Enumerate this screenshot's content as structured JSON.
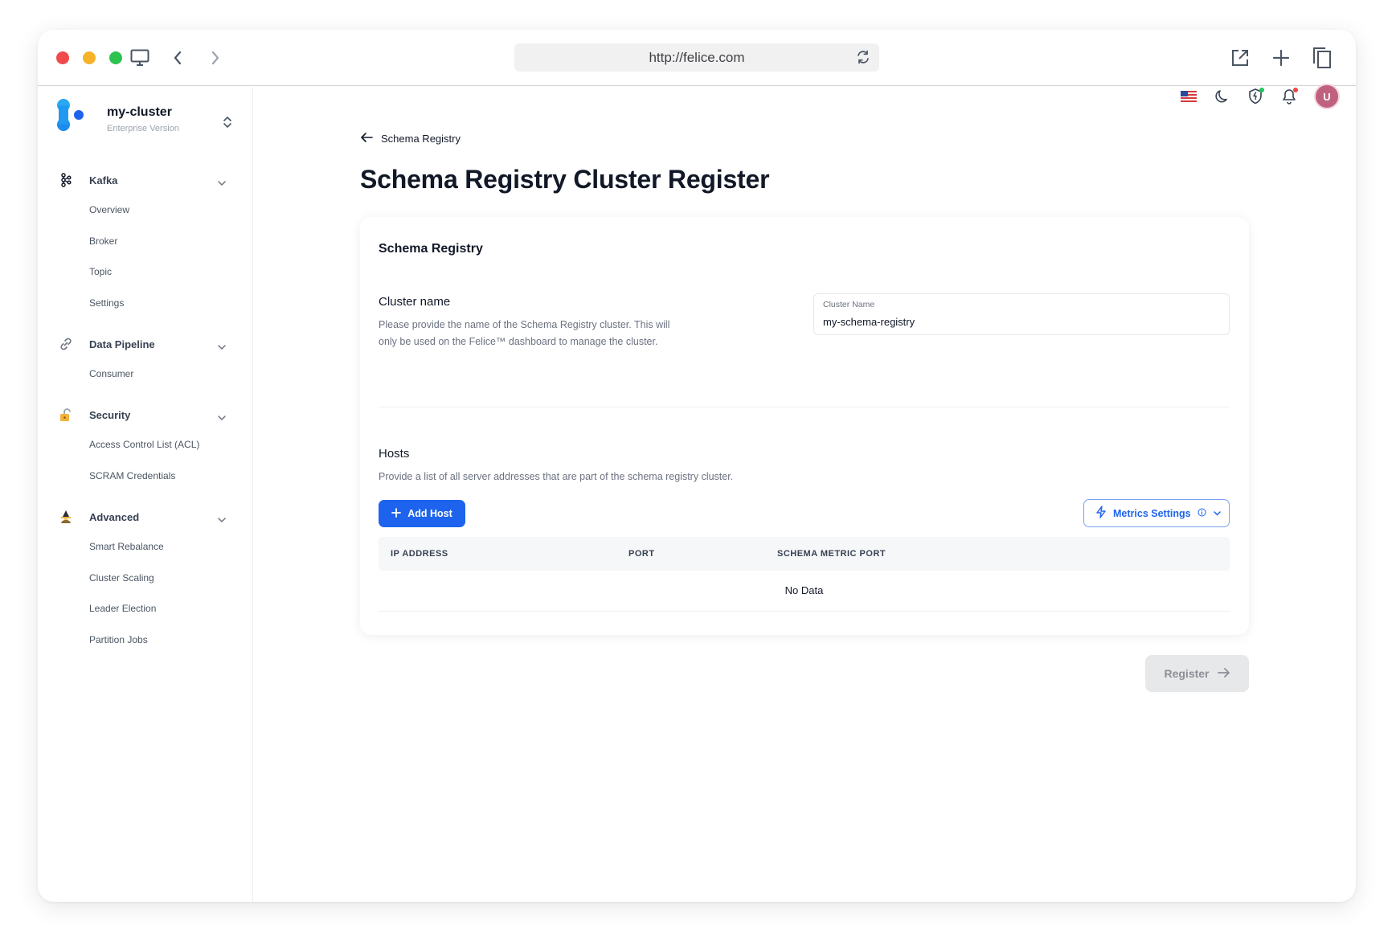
{
  "browser": {
    "url": "http://felice.com"
  },
  "sidebar": {
    "cluster_name": "my-cluster",
    "cluster_edition": "Enterprise Version",
    "groups": [
      {
        "label": "Kafka",
        "icon": "kafka-icon",
        "items": [
          "Overview",
          "Broker",
          "Topic",
          "Settings"
        ]
      },
      {
        "label": "Data Pipeline",
        "icon": "link-icon",
        "items": [
          "Consumer"
        ]
      },
      {
        "label": "Security",
        "icon": "lock-icon",
        "items": [
          "Access Control List (ACL)",
          "SCRAM Credentials"
        ]
      },
      {
        "label": "Advanced",
        "icon": "wizard-icon",
        "items": [
          "Smart Rebalance",
          "Cluster Scaling",
          "Leader Election",
          "Partition Jobs"
        ]
      }
    ]
  },
  "header": {
    "avatar_initial": "U"
  },
  "main": {
    "back_label": "Schema Registry",
    "title": "Schema Registry Cluster Register",
    "card_title": "Schema Registry",
    "cluster_section": {
      "title": "Cluster name",
      "description": "Please provide the name of the Schema Registry cluster. This will only be used on the Felice™ dashboard to manage the cluster.",
      "field_label": "Cluster Name",
      "field_value": "my-schema-registry"
    },
    "hosts_section": {
      "title": "Hosts",
      "description": "Provide a list of all server addresses that are part of the schema registry cluster.",
      "add_button": "Add Host",
      "metrics_button": "Metrics Settings",
      "columns": [
        "IP ADDRESS",
        "PORT",
        "SCHEMA METRIC PORT"
      ],
      "empty_text": "No Data"
    },
    "register_button": "Register"
  },
  "colors": {
    "primary": "#1d63ed",
    "logo_light": "#2aa8f2",
    "logo_dark": "#1d63ed"
  }
}
